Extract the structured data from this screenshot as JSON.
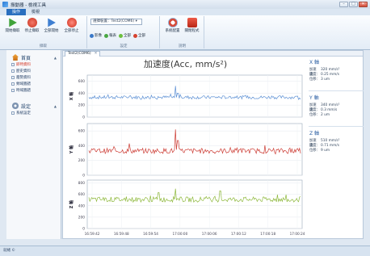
{
  "window": {
    "title": "振動器 - 檢視工具",
    "minimize": "–",
    "maximize": "□",
    "close": "✕"
  },
  "menu": {
    "tabs": [
      "操作",
      "檢視"
    ]
  },
  "ribbon": {
    "groups": [
      {
        "label": "擷取",
        "buttons": [
          {
            "label": "開始擷取",
            "icon": "play-icon"
          },
          {
            "label": "停止擷取",
            "icon": "stop-icon"
          },
          {
            "label": "全部開始",
            "icon": "play-all-icon"
          },
          {
            "label": "全部停止",
            "icon": "close-icon"
          }
        ]
      },
      {
        "label": "設定",
        "select_value": "選擇裝置：Test2(COM6) ▾",
        "radios": [
          "影像",
          "報表",
          "全部",
          "全部"
        ]
      },
      {
        "label": "說明",
        "buttons": [
          {
            "label": "系統配置",
            "icon": "settings-icon"
          },
          {
            "label": "關閉程式",
            "icon": "exit-icon"
          }
        ]
      }
    ]
  },
  "sidebar": {
    "sections": [
      {
        "title": "首頁",
        "items": [
          "即時資料",
          "歷史資料",
          "趨勢資料",
          "頻域圖譜",
          "時域圖譜"
        ]
      },
      {
        "title": "設定",
        "items": [
          "系統設定"
        ]
      }
    ]
  },
  "document": {
    "tab_label": "Test2(COM6)",
    "tab_close": "✕"
  },
  "chart_data": [
    {
      "type": "line",
      "title": "加速度(Acc, mm/s²)",
      "panels": [
        {
          "ylabel": "X 軸",
          "yticks": [
            0,
            200,
            400,
            600
          ],
          "ylim": [
            0,
            700
          ],
          "color": "#5b8fd4",
          "baseline": 330,
          "noise": 55,
          "spikes": [
            [
              0.41,
              520
            ],
            [
              0.42,
              400
            ]
          ]
        },
        {
          "ylabel": "Y 軸",
          "yticks": [
            0,
            200,
            400,
            600
          ],
          "ylim": [
            0,
            700
          ],
          "color": "#cc3b33",
          "baseline": 330,
          "noise": 70,
          "spikes": [
            [
              0.41,
              620
            ],
            [
              0.42,
              470
            ],
            [
              0.19,
              430
            ]
          ]
        },
        {
          "ylabel": "Z 軸",
          "yticks": [
            0,
            200,
            400,
            600,
            800
          ],
          "ylim": [
            0,
            850
          ],
          "color": "#8db83b",
          "baseline": 510,
          "noise": 90,
          "spikes": [
            [
              0.41,
              700
            ],
            [
              0.62,
              660
            ],
            [
              0.33,
              630
            ]
          ]
        }
      ],
      "xticks": [
        "16:59:42",
        "16:59:48",
        "16:59:54",
        "17:00:00",
        "17:00:06",
        "17:00:12",
        "17:00:18",
        "17:00:24"
      ]
    }
  ],
  "info": [
    {
      "title": "X 軸",
      "rows": [
        [
          "加速度：",
          "320 mm/s²"
        ],
        [
          "速度：",
          "0.25 mm/s"
        ],
        [
          "位移：",
          "3 um"
        ]
      ]
    },
    {
      "title": "Y 軸",
      "rows": [
        [
          "加速度：",
          "340 mm/s²"
        ],
        [
          "速度：",
          "0.3 mm/s"
        ],
        [
          "位移：",
          "2 um"
        ]
      ]
    },
    {
      "title": "Z 軸",
      "rows": [
        [
          "加速度：",
          "510 mm/s²"
        ],
        [
          "速度：",
          "0.71 mm/s"
        ],
        [
          "位移：",
          "9 um"
        ]
      ]
    }
  ],
  "status": {
    "text": "就緒 ©"
  }
}
